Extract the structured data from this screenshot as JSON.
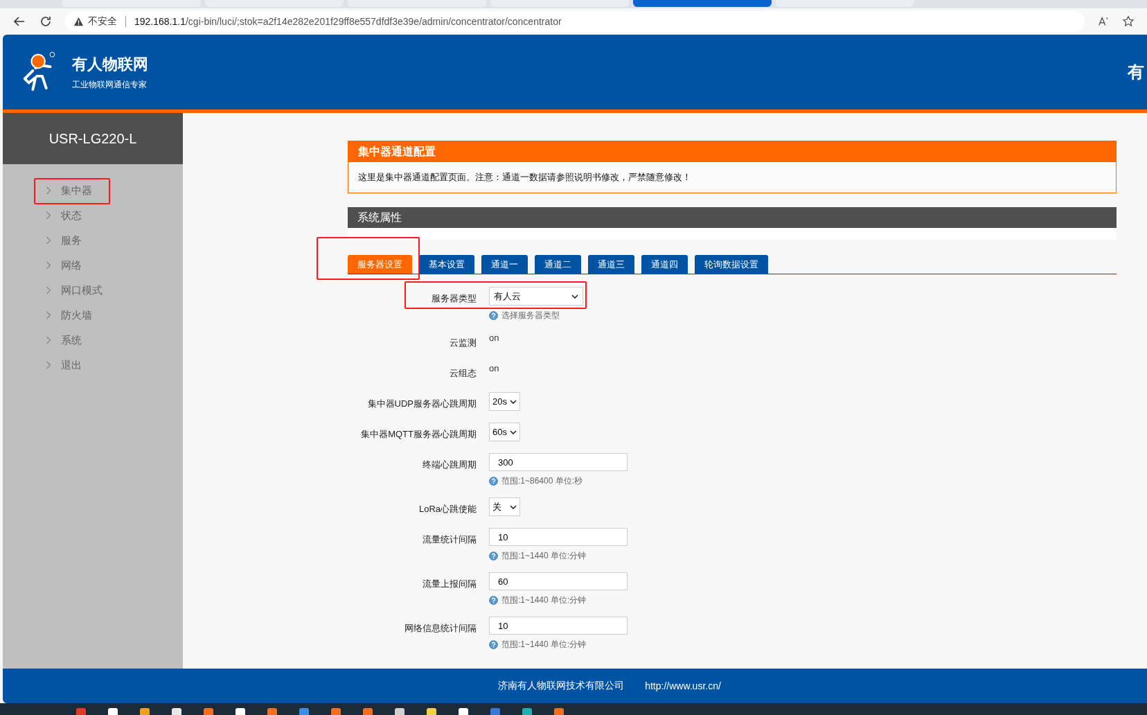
{
  "browser": {
    "security": "不安全",
    "url_host": "192.168.1.1",
    "url_path": "/cgi-bin/luci/;stok=a2f14e282e201f29ff8e557dfdf3e39e/admin/concentrator/concentrator"
  },
  "header": {
    "brand": "有人物联网",
    "slogan": "工业物联网通信专家",
    "right_text": "有"
  },
  "sidebar": {
    "device": "USR-LG220-L",
    "items": [
      {
        "label": "集中器"
      },
      {
        "label": "状态"
      },
      {
        "label": "服务"
      },
      {
        "label": "网络"
      },
      {
        "label": "网口模式"
      },
      {
        "label": "防火墙"
      },
      {
        "label": "系统"
      },
      {
        "label": "退出"
      }
    ]
  },
  "notice": {
    "title": "集中器通道配置",
    "text": "这里是集中器通道配置页面。注意：通道一数据请参照说明书修改，严禁随意修改！"
  },
  "section": {
    "title": "系统属性"
  },
  "tabs": [
    {
      "label": "服务器设置",
      "selected": true
    },
    {
      "label": "基本设置",
      "selected": false
    },
    {
      "label": "通道一",
      "selected": false
    },
    {
      "label": "通道二",
      "selected": false
    },
    {
      "label": "通道三",
      "selected": false
    },
    {
      "label": "通道四",
      "selected": false
    },
    {
      "label": "轮询数据设置",
      "selected": false
    }
  ],
  "fields": [
    {
      "kind": "select",
      "label": "服务器类型",
      "value": "有人云",
      "hint": "选择服务器类型"
    },
    {
      "kind": "text",
      "label": "云监测",
      "value": "on"
    },
    {
      "kind": "text",
      "label": "云组态",
      "value": "on"
    },
    {
      "kind": "select",
      "label": "集中器UDP服务器心跳周期",
      "value": "20s"
    },
    {
      "kind": "select",
      "label": "集中器MQTT服务器心跳周期",
      "value": "60s"
    },
    {
      "kind": "input",
      "label": "终端心跳周期",
      "value": "300",
      "hint": "范围:1~86400 单位:秒"
    },
    {
      "kind": "select",
      "label": "LoRa心跳使能",
      "value": "关"
    },
    {
      "kind": "input",
      "label": "流量统计间隔",
      "value": "10",
      "hint": "范围:1~1440 单位:分钟"
    },
    {
      "kind": "input",
      "label": "流量上报间隔",
      "value": "60",
      "hint": "范围:1~1440 单位:分钟"
    },
    {
      "kind": "input",
      "label": "网络信息统计间隔",
      "value": "10",
      "hint": "范围:1~1440 单位:分钟"
    }
  ],
  "footer": {
    "company": "济南有人物联网技术有限公司",
    "url": "http://www.usr.cn/"
  }
}
